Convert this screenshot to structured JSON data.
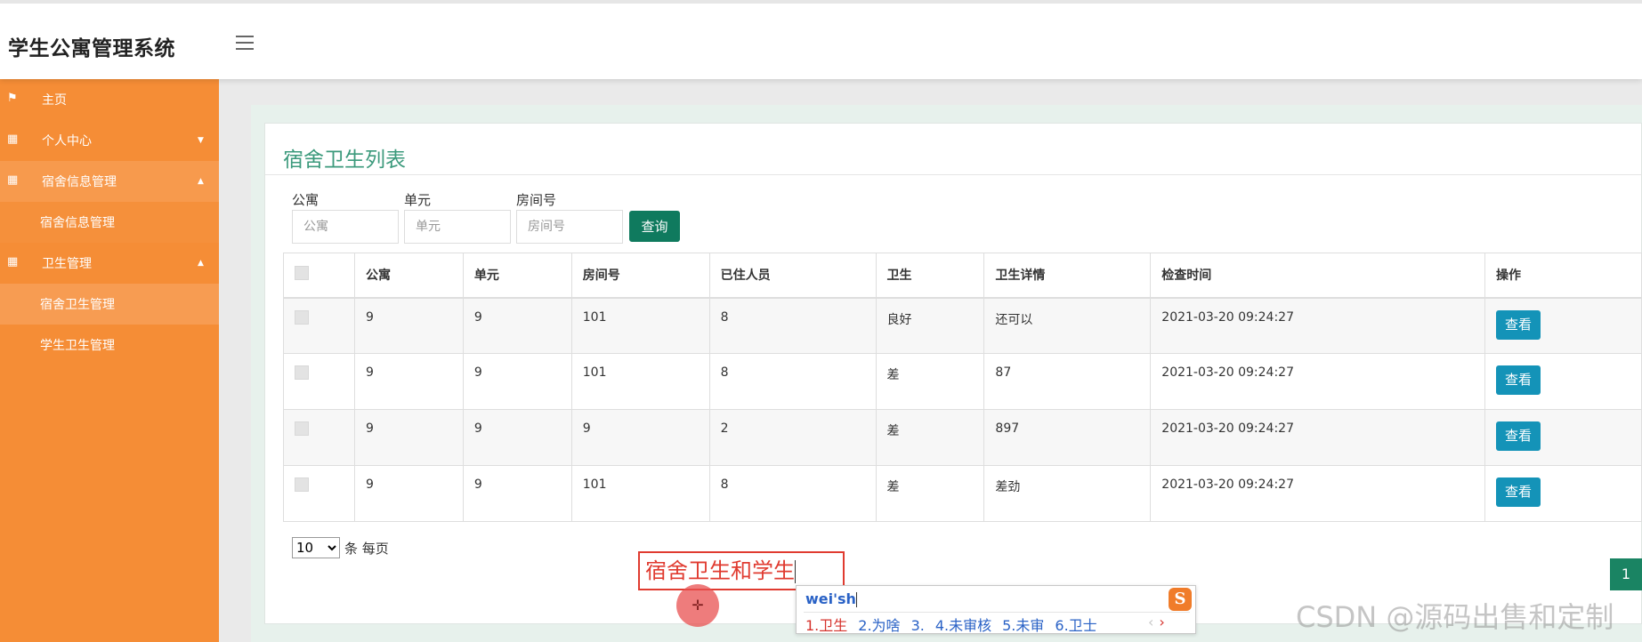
{
  "header": {
    "title": "学生公寓管理系统"
  },
  "sidebar": {
    "items": [
      {
        "label": "主页"
      },
      {
        "label": "个人中心"
      },
      {
        "label": "宿舍信息管理"
      },
      {
        "label": "宿舍信息管理"
      },
      {
        "label": "卫生管理"
      },
      {
        "label": "宿舍卫生管理"
      },
      {
        "label": "学生卫生管理"
      }
    ]
  },
  "page": {
    "title": "宿舍卫生列表",
    "filters": [
      {
        "label": "公寓",
        "placeholder": "公寓"
      },
      {
        "label": "单元",
        "placeholder": "单元"
      },
      {
        "label": "房间号",
        "placeholder": "房间号"
      }
    ],
    "query_label": "查询"
  },
  "table": {
    "columns": [
      "公寓",
      "单元",
      "房间号",
      "已住人员",
      "卫生",
      "卫生详情",
      "检查时间",
      "操作"
    ],
    "rows": [
      {
        "apartment": "9",
        "unit": "9",
        "room": "101",
        "residents": "8",
        "hygiene": "良好",
        "detail": "还可以",
        "time": "2021-03-20 09:24:27",
        "action": "查看"
      },
      {
        "apartment": "9",
        "unit": "9",
        "room": "101",
        "residents": "8",
        "hygiene": "差",
        "detail": "87",
        "time": "2021-03-20 09:24:27",
        "action": "查看"
      },
      {
        "apartment": "9",
        "unit": "9",
        "room": "9",
        "residents": "2",
        "hygiene": "差",
        "detail": "897",
        "time": "2021-03-20 09:24:27",
        "action": "查看"
      },
      {
        "apartment": "9",
        "unit": "9",
        "room": "101",
        "residents": "8",
        "hygiene": "差",
        "detail": "差劲",
        "time": "2021-03-20 09:24:27",
        "action": "查看"
      }
    ]
  },
  "pagination": {
    "per_page_value": "10",
    "per_page_text": "条 每页",
    "current_page": "1"
  },
  "annotation": {
    "text": "宿舍卫生和学生"
  },
  "ime": {
    "input": "wei'sh",
    "logo": "S",
    "candidates": [
      "1.卫生",
      "2.为啥",
      "3.",
      "4.未审核",
      "5.未审",
      "6.卫士"
    ],
    "prev": "‹",
    "next": "›"
  },
  "watermark": "CSDN @源码出售和定制",
  "colors": {
    "sidebar": "#f58d36",
    "accent": "#3c9a7c",
    "query_button": "#0f7a5e",
    "view_button": "#1493b8",
    "page_button": "#1a8463"
  }
}
